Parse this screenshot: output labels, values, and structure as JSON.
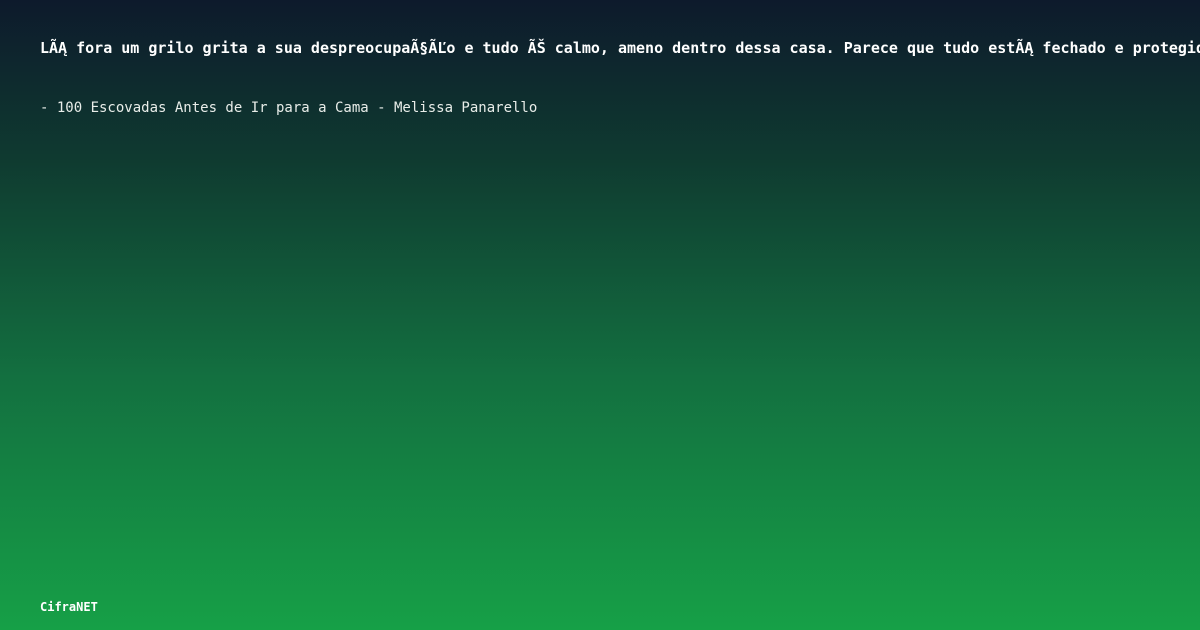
{
  "quote": {
    "text": "LÃĄ fora um grilo grita a sua despreocupaÃ§ÃĽo e tudo ÃŠ calmo, ameno dentro dessa casa. Parece que tudo estÃĄ fechado e protegid"
  },
  "source": {
    "text": "- 100 Escovadas Antes de Ir para a Cama - Melissa Panarello"
  },
  "brand": {
    "name": "CifraNET"
  },
  "colors": {
    "gradient_top": "#0d1a2c",
    "gradient_bottom": "#16a047",
    "text": "#ffffff"
  }
}
